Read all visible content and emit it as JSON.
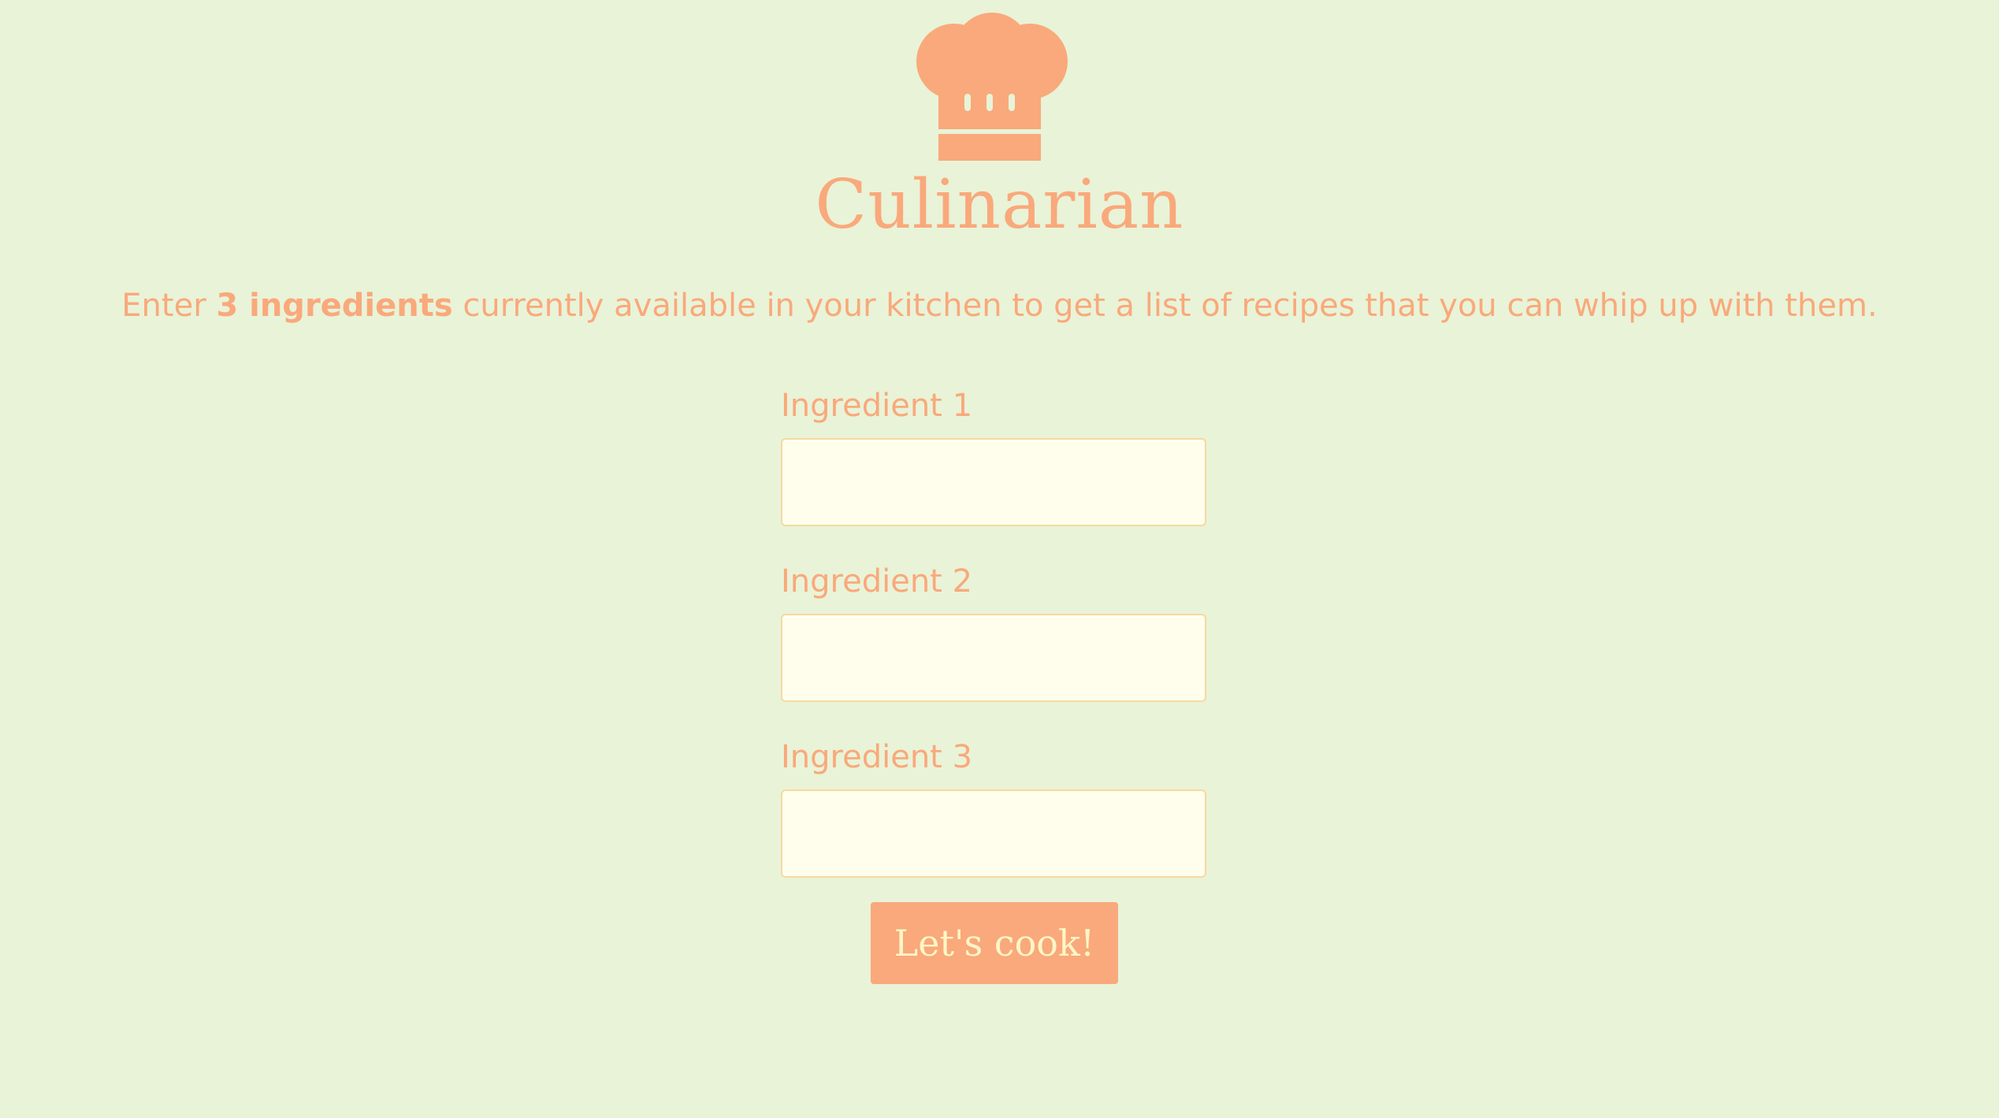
{
  "app": {
    "title": "Culinarian",
    "logo_icon": "chef-hat-icon",
    "accent_color": "#f9a97b",
    "background_color": "#e9f3d8",
    "input_background_color": "#fffeed",
    "button_text_color": "#fff6c6"
  },
  "intro": {
    "before": "Enter ",
    "emphasis": "3 ingredients",
    "after": " currently available in your kitchen to get a list of recipes that you can whip up with them."
  },
  "form": {
    "fields": [
      {
        "label": "Ingredient 1",
        "value": "",
        "placeholder": ""
      },
      {
        "label": "Ingredient 2",
        "value": "",
        "placeholder": ""
      },
      {
        "label": "Ingredient 3",
        "value": "",
        "placeholder": ""
      }
    ],
    "submit_label": "Let's cook!"
  }
}
